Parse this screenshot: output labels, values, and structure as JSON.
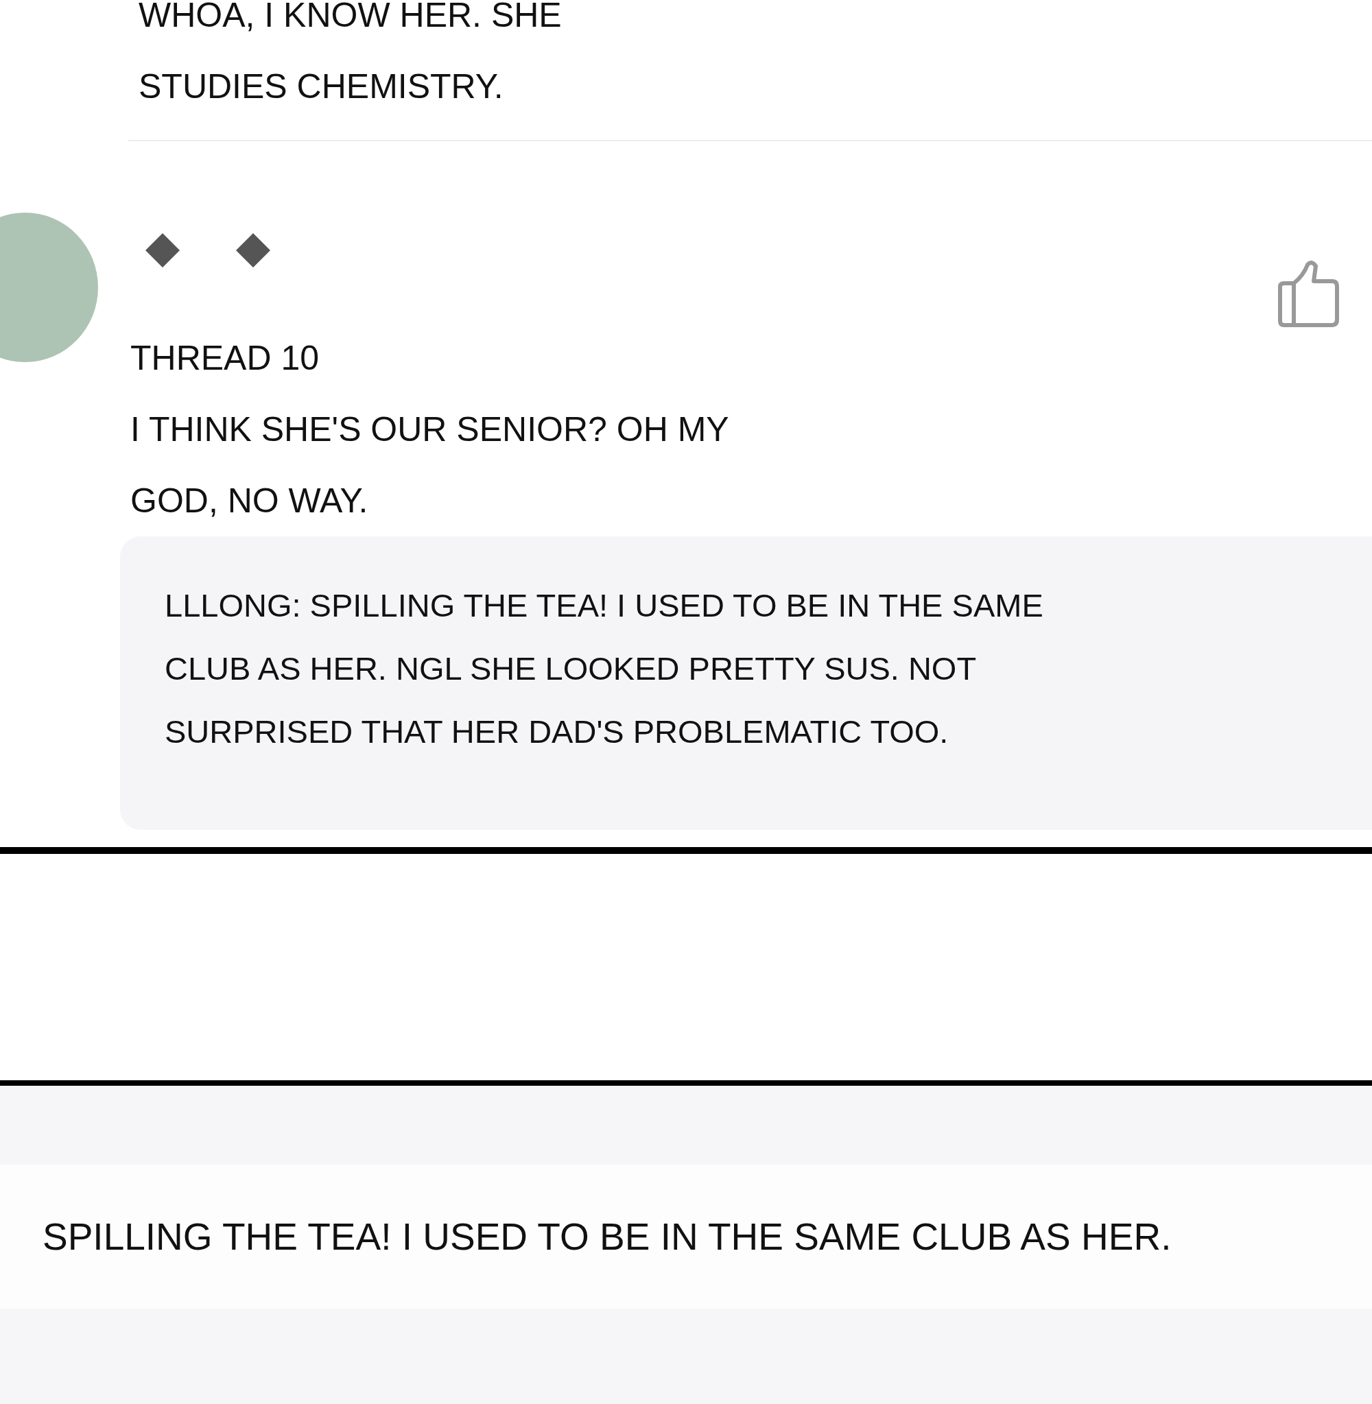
{
  "previous_comment": {
    "lines": [
      "WHOA, I KNOW HER. SHE",
      "STUDIES CHEMISTRY."
    ]
  },
  "comment": {
    "username": "THREAD 10",
    "lines": [
      "I THINK SHE'S OUR SENIOR? OH MY",
      "GOD, NO WAY."
    ],
    "reply_preview": {
      "lines": [
        "LLLONG: SPILLING THE TEA! I USED TO BE IN THE SAME",
        "CLUB AS HER. NGL SHE LOOKED PRETTY SUS. NOT",
        "SURPRISED THAT HER DAD'S PROBLEMATIC TOO."
      ]
    }
  },
  "next_panel": {
    "text": "SPILLING THE TEA! I USED TO BE IN THE SAME CLUB AS HER."
  }
}
